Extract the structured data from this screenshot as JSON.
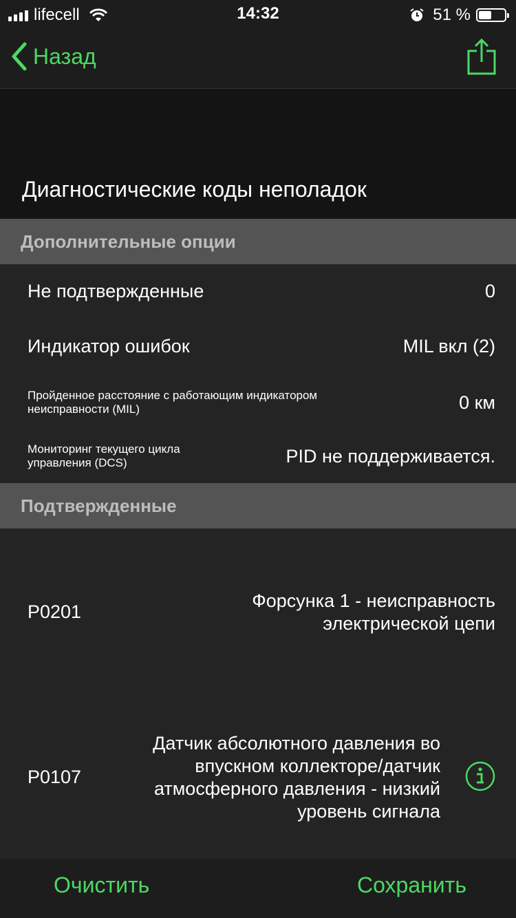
{
  "status_bar": {
    "carrier": "lifecell",
    "time": "14:32",
    "battery_percent": "51 %",
    "battery_level": 0.51
  },
  "nav": {
    "back_label": "Назад",
    "accent_color": "#4cd964"
  },
  "page_title": "Диагностические коды неполадок",
  "sections": {
    "options": {
      "header": "Дополнительные опции",
      "rows": [
        {
          "label": "Не подтвержденные",
          "value": "0"
        },
        {
          "label": "Индикатор ошибок",
          "value": "MIL вкл (2)"
        },
        {
          "label": "Пройденное расстояние с работающим индикатором неисправности (MIL)",
          "value": "0 км"
        },
        {
          "label": "Мониторинг текущего цикла управления (DCS)",
          "value": "PID не поддерживается."
        }
      ]
    },
    "confirmed": {
      "header": "Подтвержденные",
      "codes": [
        {
          "code": "P0201",
          "description": "Форсунка 1 - неисправность электрической цепи"
        },
        {
          "code": "P0107",
          "description": "Датчик абсолютного давления во впускном коллекторе/датчик атмосферного давления - низкий уровень сигнала"
        }
      ]
    }
  },
  "bottom_bar": {
    "clear_label": "Очистить",
    "save_label": "Сохранить"
  }
}
